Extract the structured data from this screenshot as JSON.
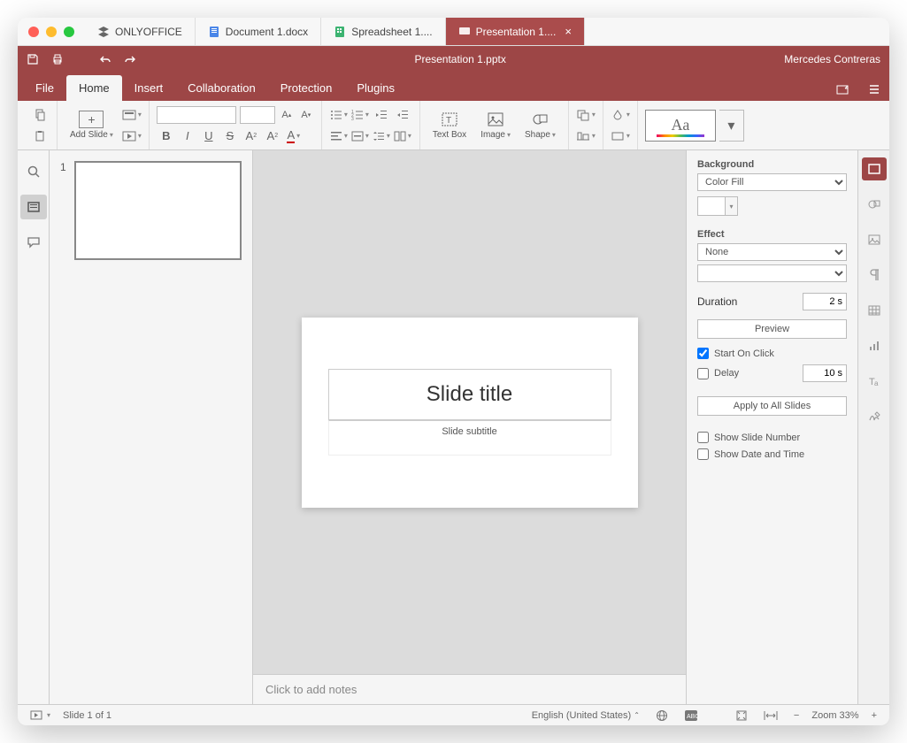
{
  "app_name": "ONLYOFFICE",
  "tabs": [
    {
      "label": "Document 1.docx",
      "icon": "doc"
    },
    {
      "label": "Spreadsheet 1....",
      "icon": "sheet"
    },
    {
      "label": "Presentation 1....",
      "icon": "pres",
      "active": true
    }
  ],
  "doc_title": "Presentation 1.pptx",
  "user_name": "Mercedes Contreras",
  "menu": {
    "file": "File",
    "home": "Home",
    "insert": "Insert",
    "collaboration": "Collaboration",
    "protection": "Protection",
    "plugins": "Plugins"
  },
  "ribbon": {
    "add_slide": "Add Slide",
    "text_box": "Text Box",
    "image": "Image",
    "shape": "Shape",
    "theme": "Aa"
  },
  "slide": {
    "number": "1",
    "title": "Slide title",
    "subtitle": "Slide subtitle"
  },
  "notes_placeholder": "Click to add notes",
  "props": {
    "background_label": "Background",
    "background_fill": "Color Fill",
    "effect_label": "Effect",
    "effect_value": "None",
    "duration_label": "Duration",
    "duration_value": "2 s",
    "preview": "Preview",
    "start_on_click": "Start On Click",
    "delay_label": "Delay",
    "delay_value": "10 s",
    "apply_all": "Apply to All Slides",
    "show_slide_number": "Show Slide Number",
    "show_date_time": "Show Date and Time"
  },
  "status": {
    "slide_info": "Slide 1 of 1",
    "language": "English (United States)",
    "zoom": "Zoom 33%"
  }
}
